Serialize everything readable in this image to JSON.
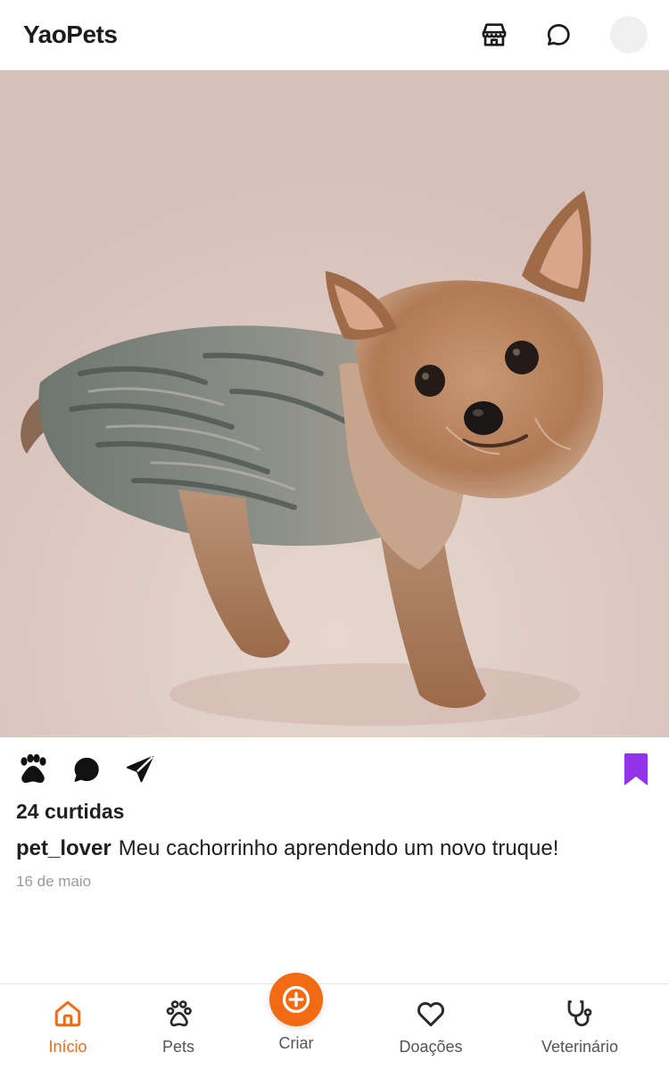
{
  "app": {
    "brand": "YaoPets"
  },
  "header": {
    "icons": [
      "shop-icon",
      "chat-bubble-icon"
    ],
    "avatar": "avatar"
  },
  "post": {
    "photo_alt": "Yorkshire terrier",
    "likes": "24 curtidas",
    "username": "pet_lover",
    "caption": "Meu cachorrinho aprendendo um novo truque!",
    "date": "16 de maio",
    "actions": [
      "paw-like-icon",
      "comment-icon",
      "share-send-icon",
      "bookmark-icon"
    ],
    "bookmark_color": "#9333ea"
  },
  "nav": {
    "accent": "#f26b12",
    "items": [
      {
        "label": "Início",
        "icon": "home-icon",
        "active": true
      },
      {
        "label": "Pets",
        "icon": "paw-outline-icon",
        "active": false
      },
      {
        "label": "Criar",
        "icon": "plus-circle-icon",
        "active": false
      },
      {
        "label": "Doações",
        "icon": "heart-icon",
        "active": false
      },
      {
        "label": "Veterinário",
        "icon": "stethoscope-icon",
        "active": false
      }
    ]
  }
}
